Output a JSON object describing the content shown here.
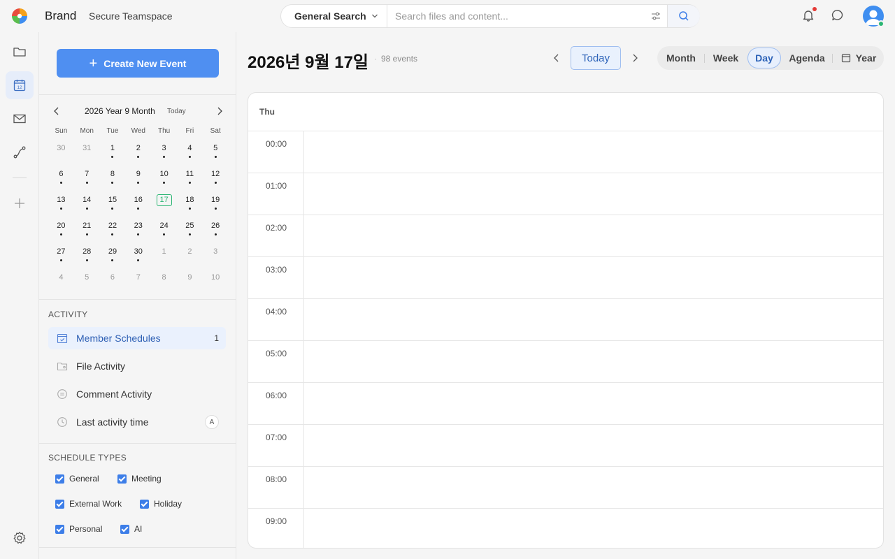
{
  "app": {
    "brand": "Brand",
    "workspace": "Secure Teamspace"
  },
  "search": {
    "scope": "General Search",
    "placeholder": "Search files and content..."
  },
  "sidebar": {
    "create_label": "Create New Event"
  },
  "mini_calendar": {
    "title": "2026 Year 9 Month",
    "today_label": "Today",
    "weekdays": [
      "Sun",
      "Mon",
      "Tue",
      "Wed",
      "Thu",
      "Fri",
      "Sat"
    ],
    "weeks": [
      [
        {
          "d": "30",
          "m": true,
          "dot": false
        },
        {
          "d": "31",
          "m": true,
          "dot": false
        },
        {
          "d": "1",
          "m": false,
          "dot": true
        },
        {
          "d": "2",
          "m": false,
          "dot": true
        },
        {
          "d": "3",
          "m": false,
          "dot": true
        },
        {
          "d": "4",
          "m": false,
          "dot": true
        },
        {
          "d": "5",
          "m": false,
          "dot": true
        }
      ],
      [
        {
          "d": "6",
          "m": false,
          "dot": true
        },
        {
          "d": "7",
          "m": false,
          "dot": true
        },
        {
          "d": "8",
          "m": false,
          "dot": true
        },
        {
          "d": "9",
          "m": false,
          "dot": true
        },
        {
          "d": "10",
          "m": false,
          "dot": true
        },
        {
          "d": "11",
          "m": false,
          "dot": true
        },
        {
          "d": "12",
          "m": false,
          "dot": true
        }
      ],
      [
        {
          "d": "13",
          "m": false,
          "dot": true
        },
        {
          "d": "14",
          "m": false,
          "dot": true
        },
        {
          "d": "15",
          "m": false,
          "dot": true
        },
        {
          "d": "16",
          "m": false,
          "dot": true
        },
        {
          "d": "17",
          "m": false,
          "dot": false,
          "today": true
        },
        {
          "d": "18",
          "m": false,
          "dot": true
        },
        {
          "d": "19",
          "m": false,
          "dot": true
        }
      ],
      [
        {
          "d": "20",
          "m": false,
          "dot": true
        },
        {
          "d": "21",
          "m": false,
          "dot": true
        },
        {
          "d": "22",
          "m": false,
          "dot": true
        },
        {
          "d": "23",
          "m": false,
          "dot": true
        },
        {
          "d": "24",
          "m": false,
          "dot": true
        },
        {
          "d": "25",
          "m": false,
          "dot": true
        },
        {
          "d": "26",
          "m": false,
          "dot": true
        }
      ],
      [
        {
          "d": "27",
          "m": false,
          "dot": true
        },
        {
          "d": "28",
          "m": false,
          "dot": true
        },
        {
          "d": "29",
          "m": false,
          "dot": true
        },
        {
          "d": "30",
          "m": false,
          "dot": true
        },
        {
          "d": "1",
          "m": true,
          "dot": false
        },
        {
          "d": "2",
          "m": true,
          "dot": false
        },
        {
          "d": "3",
          "m": true,
          "dot": false
        }
      ],
      [
        {
          "d": "4",
          "m": true,
          "dot": false
        },
        {
          "d": "5",
          "m": true,
          "dot": false
        },
        {
          "d": "6",
          "m": true,
          "dot": false
        },
        {
          "d": "7",
          "m": true,
          "dot": false
        },
        {
          "d": "8",
          "m": true,
          "dot": false
        },
        {
          "d": "9",
          "m": true,
          "dot": false
        },
        {
          "d": "10",
          "m": true,
          "dot": false
        }
      ]
    ]
  },
  "activity": {
    "title": "ACTIVITY",
    "items": [
      {
        "label": "Member Schedules",
        "count": "1",
        "icon": "calendar-check-icon"
      },
      {
        "label": "File Activity",
        "icon": "folder-user-icon"
      },
      {
        "label": "Comment Activity",
        "icon": "comment-icon"
      },
      {
        "label": "Last activity time",
        "badge": "A",
        "icon": "clock-icon"
      }
    ]
  },
  "schedule_types": {
    "title": "SCHEDULE TYPES",
    "items": [
      {
        "label": "General",
        "checked": true
      },
      {
        "label": "Meeting",
        "checked": true
      },
      {
        "label": "External Work",
        "checked": true
      },
      {
        "label": "Holiday",
        "checked": true
      },
      {
        "label": "Personal",
        "checked": true
      },
      {
        "label": "AI",
        "checked": true
      }
    ]
  },
  "main": {
    "title": "2026년 9월 17일",
    "event_count": "98 events",
    "today_label": "Today",
    "views": [
      "Month",
      "Week",
      "Day",
      "Agenda",
      "Year"
    ],
    "active_view": "Day",
    "day_name": "Thu",
    "hours": [
      "00:00",
      "01:00",
      "02:00",
      "03:00",
      "04:00",
      "05:00",
      "06:00",
      "07:00",
      "08:00",
      "09:00"
    ]
  },
  "colors": {
    "accent": "#4f8ff1",
    "today": "#2bb673",
    "notification": "#e53935"
  }
}
